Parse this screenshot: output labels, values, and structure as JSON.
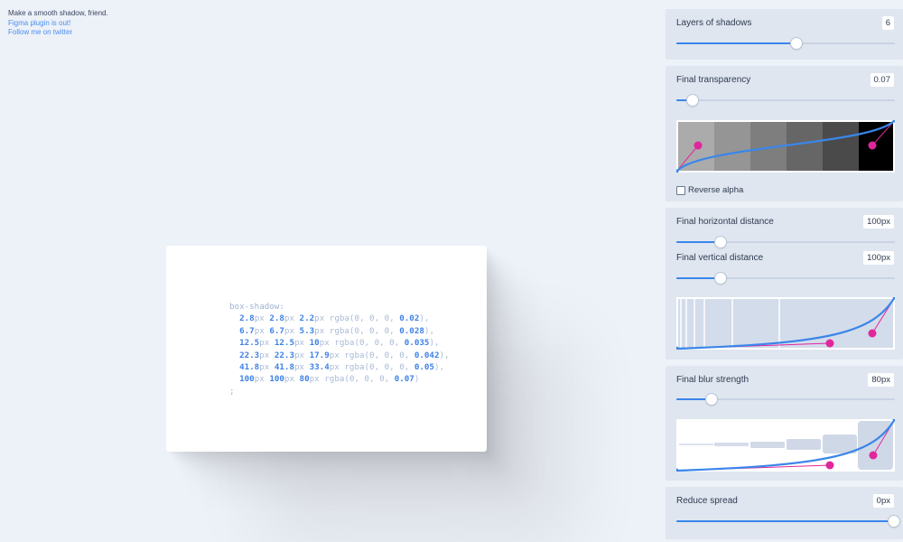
{
  "intro": {
    "tagline": "Make a smooth shadow, friend.",
    "plugin_link": "Figma plugin is out!",
    "twitter_link": "Follow me on twitter"
  },
  "code": {
    "property": "box-shadow:",
    "layers": [
      {
        "x": "2.8",
        "y": "2.8",
        "blur": "2.2",
        "alpha": "0.02",
        "sep": ","
      },
      {
        "x": "6.7",
        "y": "6.7",
        "blur": "5.3",
        "alpha": "0.028",
        "sep": ","
      },
      {
        "x": "12.5",
        "y": "12.5",
        "blur": "10",
        "alpha": "0.035",
        "sep": ","
      },
      {
        "x": "22.3",
        "y": "22.3",
        "blur": "17.9",
        "alpha": "0.042",
        "sep": ","
      },
      {
        "x": "41.8",
        "y": "41.8",
        "blur": "33.4",
        "alpha": "0.05",
        "sep": ","
      },
      {
        "x": "100",
        "y": "100",
        "blur": "80",
        "alpha": "0.07",
        "sep": ""
      }
    ],
    "unit": "px",
    "rgba_prefix": "rgba(0, 0, 0, ",
    "rgba_suffix": ")",
    "terminator": ";"
  },
  "controls": {
    "layers": {
      "label": "Layers of shadows",
      "value": "6",
      "fraction": 0.55
    },
    "transparency": {
      "label": "Final transparency",
      "value": "0.07",
      "fraction": 0.07
    },
    "reverse_alpha": {
      "label": "Reverse alpha",
      "checked": false
    },
    "horizontal": {
      "label": "Final horizontal distance",
      "value": "100px",
      "fraction": 0.2
    },
    "vertical": {
      "label": "Final vertical distance",
      "value": "100px",
      "fraction": 0.2
    },
    "blur": {
      "label": "Final blur strength",
      "value": "80px",
      "fraction": 0.16
    },
    "spread": {
      "label": "Reduce spread",
      "value": "0px",
      "fraction": 1.0
    }
  },
  "colors": {
    "accent": "#3a86ea",
    "handle": "#e0279b",
    "panel_bg": "#dfe6f0",
    "page_bg": "#edf1f8"
  }
}
